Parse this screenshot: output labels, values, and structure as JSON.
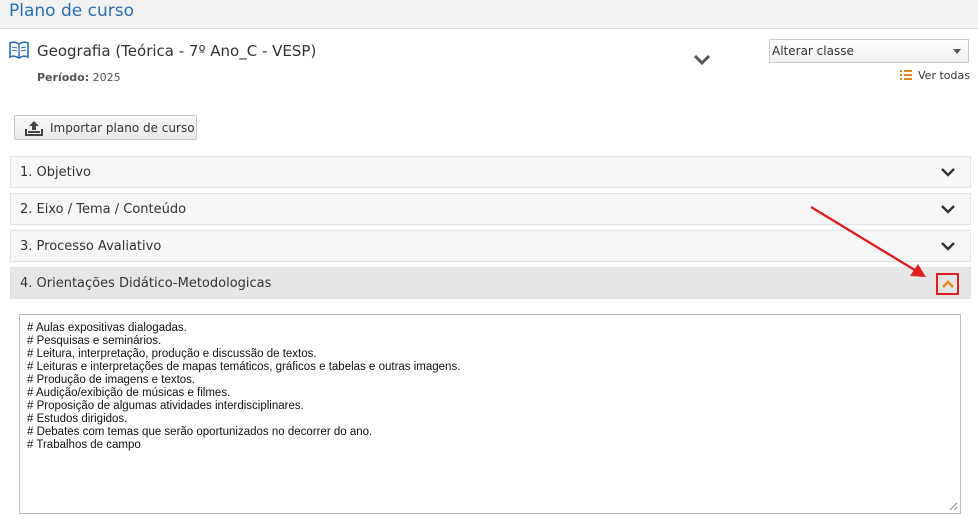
{
  "header": {
    "title": "Plano de curso"
  },
  "course": {
    "title": "Geografia (Teórica - 7º Ano_C - VESP)",
    "period_label": "Período:",
    "period_value": "2025",
    "icon": "book-icon"
  },
  "class_select": {
    "selected": "Alterar classe"
  },
  "view_all": {
    "label": "Ver todas",
    "icon": "list-icon"
  },
  "import_button": {
    "label": "Importar plano de curso",
    "icon": "upload-icon"
  },
  "sections": [
    {
      "label": "1. Objetivo",
      "expanded": false
    },
    {
      "label": "2. Eixo / Tema / Conteúdo",
      "expanded": false
    },
    {
      "label": "3. Processo Avaliativo",
      "expanded": false
    },
    {
      "label": "4. Orientações Didático-Metodologicas",
      "expanded": true
    }
  ],
  "content": {
    "lines": [
      "# Aulas expositivas dialogadas.",
      "# Pesquisas e seminários.",
      "# Leitura, interpretação, produção e discussão de textos.",
      "# Leituras e interpretações de mapas temáticos, gráficos e tabelas e outras imagens.",
      "# Produção de imagens e textos.",
      "# Audição/exibição de músicas e filmes.",
      "# Proposição de algumas atividades interdisciplinares.",
      "# Estudos dirigidos.",
      "# Debates com temas que serão oportunizados no decorrer do ano.",
      "# Trabalhos de campo"
    ]
  },
  "colors": {
    "title_blue": "#2a6fb0",
    "accent_orange": "#e08a1e",
    "annotation_red": "#e02020"
  }
}
